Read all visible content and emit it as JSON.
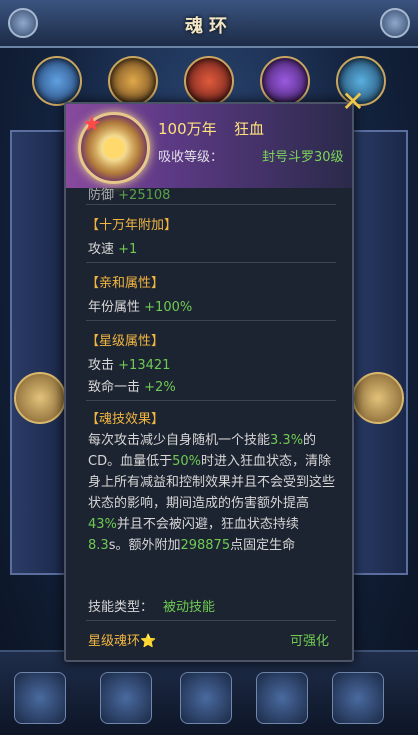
{
  "background": {
    "title": "魂环"
  },
  "header": {
    "years": "100万年",
    "name": "狂血",
    "level_label": "吸收等级：",
    "level_value": "封号斗罗30级"
  },
  "partial_line": {
    "label": "防御",
    "value": "+25108"
  },
  "sections": {
    "ten_thousand": {
      "title": "【十万年附加】",
      "label": "攻速",
      "value": "+1"
    },
    "affinity": {
      "title": "【亲和属性】",
      "label": "年份属性",
      "value": "+100%"
    },
    "star": {
      "title": "【星级属性】",
      "attack_label": "攻击",
      "attack_value": "+13421",
      "crit_label": "致命一击",
      "crit_value": "+2%"
    },
    "skill": {
      "title": "【魂技效果】",
      "parts": {
        "p1": "每次攻击减少自身随机一个技能",
        "v1": "3.3%",
        "p2": "的CD。血量低于",
        "v2": "50%",
        "p3": "时进入狂血状态，清除身上所有减益和控制效果并且不会受到这些状态的影响，期间造成的伤害额外提高",
        "v3": "43%",
        "p4": "并且不会被闪避，狂血状态持续",
        "v4": "8.3",
        "p5": "s。额外附加",
        "v5": "298875",
        "p6": "点固定生命"
      },
      "type_label": "技能类型：",
      "type_value": "被动技能"
    }
  },
  "footer": {
    "star_ring_label": "星级魂环",
    "star_icon": "⭐",
    "enhance_label": "可强化"
  },
  "close_icon": "✕",
  "colors": {
    "accent_gold": "#f2b640",
    "value_green": "#6ecb52",
    "title_yellow": "#ffe27a",
    "panel_bg": "#1d2431"
  }
}
